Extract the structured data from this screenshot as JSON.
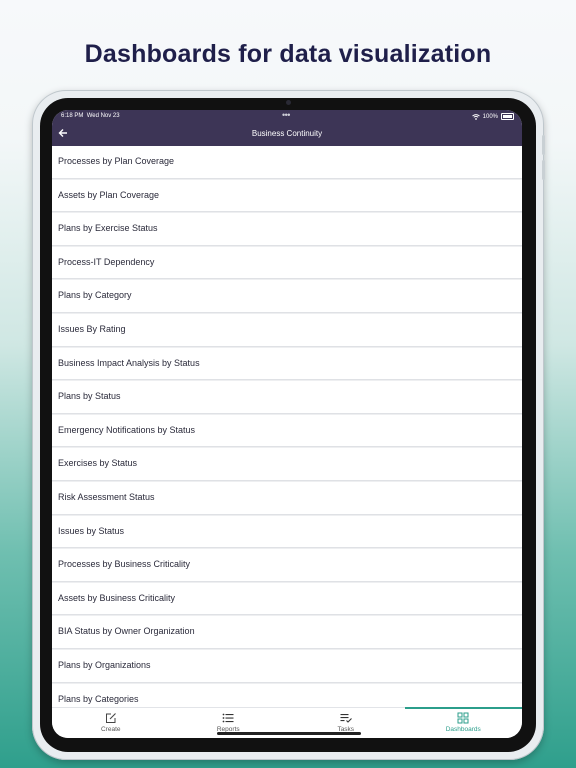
{
  "headline": "Dashboards for data visualization",
  "status_bar": {
    "time": "6:18 PM",
    "date": "Wed Nov 23",
    "battery": "100%"
  },
  "nav": {
    "title": "Business Continuity",
    "back_icon": "arrow-left-icon"
  },
  "dashboards": [
    {
      "label": "Processes by Plan Coverage"
    },
    {
      "label": "Assets by Plan Coverage"
    },
    {
      "label": "Plans by Exercise Status"
    },
    {
      "label": "Process-IT Dependency"
    },
    {
      "label": "Plans by Category"
    },
    {
      "label": "Issues By Rating"
    },
    {
      "label": "Business Impact Analysis by Status"
    },
    {
      "label": "Plans by Status"
    },
    {
      "label": "Emergency Notifications by Status"
    },
    {
      "label": "Exercises by Status"
    },
    {
      "label": "Risk Assessment Status"
    },
    {
      "label": "Issues by Status"
    },
    {
      "label": "Processes by Business Criticality"
    },
    {
      "label": "Assets by Business Criticality"
    },
    {
      "label": "BIA Status by Owner Organization"
    },
    {
      "label": "Plans by Organizations"
    },
    {
      "label": "Plans by Categories"
    }
  ],
  "tabbar": {
    "tabs": [
      {
        "label": "Create",
        "icon": "edit-icon"
      },
      {
        "label": "Reports",
        "icon": "list-icon"
      },
      {
        "label": "Tasks",
        "icon": "tasks-icon"
      },
      {
        "label": "Dashboards",
        "icon": "dashboard-icon"
      }
    ],
    "active_tab": "Dashboards"
  },
  "colors": {
    "accent": "#2b9e8b",
    "header": "#3d3556",
    "headline": "#1f1f4a"
  }
}
